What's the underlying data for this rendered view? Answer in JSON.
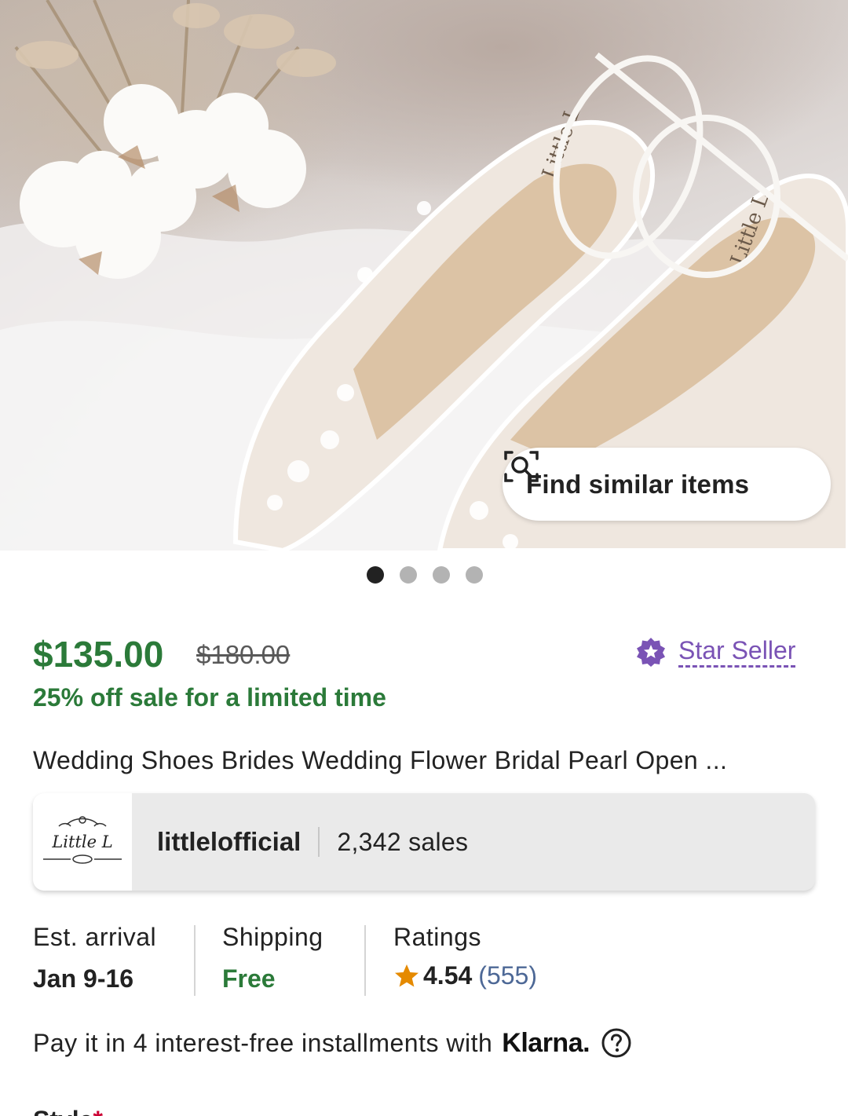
{
  "find_similar": {
    "label": "Find similar items"
  },
  "carousel": {
    "count": 4,
    "active": 0
  },
  "price": {
    "current": "$135.00",
    "original": "$180.00",
    "sale_text": "25% off sale for a limited time"
  },
  "star_seller": {
    "label": "Star Seller"
  },
  "listing": {
    "title": "Wedding Shoes Brides Wedding Flower Bridal Pearl Open ..."
  },
  "shop": {
    "logo_text": "Little L",
    "name": "littlelofficial",
    "sales": "2,342 sales"
  },
  "details": {
    "arrival_label": "Est. arrival",
    "arrival_value": "Jan 9-16",
    "shipping_label": "Shipping",
    "shipping_value": "Free",
    "ratings_label": "Ratings",
    "rating_score": "4.54",
    "rating_count": "(555)"
  },
  "klarna": {
    "text": "Pay it in 4 interest-free installments with",
    "brand": "Klarna."
  },
  "next_section": {
    "label": "Style",
    "required_mark": "*"
  },
  "colors": {
    "sale_green": "#2b7a39",
    "star_seller_purple": "#7a53b5",
    "rating_star": "#e58a00",
    "link_blue": "#4d6896"
  }
}
